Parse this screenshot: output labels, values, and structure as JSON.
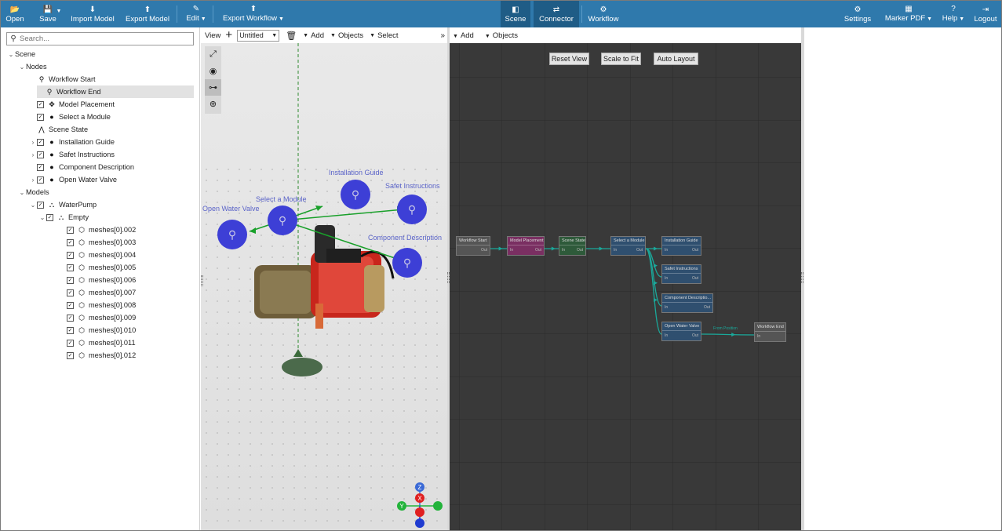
{
  "topbar": {
    "left": [
      {
        "icon": "folder-open-icon",
        "glyph": "📂",
        "label": "Open"
      },
      {
        "icon": "save-icon",
        "glyph": "💾",
        "label": "Save",
        "dropdown": true
      },
      {
        "icon": "import-model-icon",
        "glyph": "⬇",
        "label": "Import Model"
      },
      {
        "icon": "export-model-icon",
        "glyph": "⬆",
        "label": "Export Model"
      },
      {
        "icon": "edit-icon",
        "glyph": "✎",
        "label": "Edit",
        "dropdown": true
      },
      {
        "icon": "export-workflow-icon",
        "glyph": "⬆",
        "label": "Export Workflow",
        "dropdown": true
      }
    ],
    "center": [
      {
        "icon": "scene-cube-icon",
        "glyph": "◧",
        "label": "Scene"
      },
      {
        "icon": "connector-icon",
        "glyph": "⇄",
        "label": "Connector"
      },
      {
        "icon": "workflow-icon",
        "glyph": "⚙",
        "label": "Workflow"
      }
    ],
    "right": [
      {
        "icon": "settings-icon",
        "glyph": "⚙",
        "label": "Settings"
      },
      {
        "icon": "marker-pdf-icon",
        "glyph": "▦",
        "label": "Marker PDF",
        "dropdown": true
      },
      {
        "icon": "help-icon",
        "glyph": "?",
        "label": "Help",
        "dropdown": true
      },
      {
        "icon": "logout-icon",
        "glyph": "⇥",
        "label": "Logout"
      }
    ],
    "accent": "#2f79ac",
    "active_color": "#1f5c86"
  },
  "search": {
    "placeholder": "Search..."
  },
  "tree": [
    {
      "label": "Scene",
      "depth": 0,
      "twisty": "v",
      "check": false,
      "icon": ""
    },
    {
      "label": "Nodes",
      "depth": 1,
      "twisty": "v",
      "check": false,
      "icon": ""
    },
    {
      "label": "Workflow Start",
      "depth": 2,
      "twisty": "",
      "check": false,
      "icon": "pin-small-icon",
      "glyph": "⚲"
    },
    {
      "label": "Workflow End",
      "depth": 2,
      "twisty": "",
      "check": false,
      "icon": "pin-end-icon",
      "glyph": "⚲",
      "selected": true
    },
    {
      "label": "Model Placement",
      "depth": 2,
      "twisty": "",
      "check": true,
      "icon": "move-arrows-icon",
      "glyph": "✥"
    },
    {
      "label": "Select a Module",
      "depth": 2,
      "twisty": "",
      "check": true,
      "icon": "location-pin-icon",
      "glyph": "●"
    },
    {
      "label": "Scene State",
      "depth": 2,
      "twisty": "",
      "check": false,
      "icon": "state-graph-icon",
      "glyph": "⋀"
    },
    {
      "label": "Installation Guide",
      "depth": 2,
      "twisty": ">",
      "check": true,
      "icon": "location-pin-icon",
      "glyph": "●"
    },
    {
      "label": "Safet Instructions",
      "depth": 2,
      "twisty": ">",
      "check": true,
      "icon": "location-pin-icon",
      "glyph": "●"
    },
    {
      "label": "Component Description",
      "depth": 2,
      "twisty": "",
      "check": true,
      "icon": "location-pin-icon",
      "glyph": "●"
    },
    {
      "label": "Open Water Valve",
      "depth": 2,
      "twisty": ">",
      "check": true,
      "icon": "location-pin-icon",
      "glyph": "●"
    },
    {
      "label": "Models",
      "depth": 1,
      "twisty": "v",
      "check": false,
      "icon": ""
    },
    {
      "label": "WaterPump",
      "depth": 2,
      "twisty": "v",
      "check": true,
      "icon": "hierarchy-icon",
      "glyph": "⛬"
    },
    {
      "label": "Empty",
      "depth": 3,
      "twisty": "v",
      "check": true,
      "icon": "hierarchy-icon",
      "glyph": "⛬"
    },
    {
      "label": "meshes[0].002",
      "depth": 4,
      "twisty": "",
      "check": true,
      "icon": "mesh-cube-icon",
      "glyph": "⬡"
    },
    {
      "label": "meshes[0].003",
      "depth": 4,
      "twisty": "",
      "check": true,
      "icon": "mesh-cube-icon",
      "glyph": "⬡"
    },
    {
      "label": "meshes[0].004",
      "depth": 4,
      "twisty": "",
      "check": true,
      "icon": "mesh-cube-icon",
      "glyph": "⬡"
    },
    {
      "label": "meshes[0].005",
      "depth": 4,
      "twisty": "",
      "check": true,
      "icon": "mesh-cube-icon",
      "glyph": "⬡"
    },
    {
      "label": "meshes[0].006",
      "depth": 4,
      "twisty": "",
      "check": true,
      "icon": "mesh-cube-icon",
      "glyph": "⬡"
    },
    {
      "label": "meshes[0].007",
      "depth": 4,
      "twisty": "",
      "check": true,
      "icon": "mesh-cube-icon",
      "glyph": "⬡"
    },
    {
      "label": "meshes[0].008",
      "depth": 4,
      "twisty": "",
      "check": true,
      "icon": "mesh-cube-icon",
      "glyph": "⬡"
    },
    {
      "label": "meshes[0].009",
      "depth": 4,
      "twisty": "",
      "check": true,
      "icon": "mesh-cube-icon",
      "glyph": "⬡"
    },
    {
      "label": "meshes[0].010",
      "depth": 4,
      "twisty": "",
      "check": true,
      "icon": "mesh-cube-icon",
      "glyph": "⬡"
    },
    {
      "label": "meshes[0].011",
      "depth": 4,
      "twisty": "",
      "check": true,
      "icon": "mesh-cube-icon",
      "glyph": "⬡"
    },
    {
      "label": "meshes[0].012",
      "depth": 4,
      "twisty": "",
      "check": true,
      "icon": "mesh-cube-icon",
      "glyph": "⬡"
    }
  ],
  "scene_toolbar": {
    "view_label": "View",
    "add_icon": "plus-icon",
    "document_name": "Untitled",
    "delete_icon": "trash-icon",
    "add_label": "Add",
    "objects_label": "Objects",
    "select_label": "Select",
    "overflow": "»"
  },
  "viewport": {
    "tools": [
      {
        "icon": "expand-icon",
        "glyph": "⤢"
      },
      {
        "icon": "eye-icon",
        "glyph": "◉"
      },
      {
        "icon": "connector-link-icon",
        "glyph": "⊶",
        "active": true
      },
      {
        "icon": "move-gizmo-icon",
        "glyph": "⊕"
      }
    ],
    "markers": [
      {
        "label": "Installation Guide"
      },
      {
        "label": "Select a Module"
      },
      {
        "label": "Safet Instructions"
      },
      {
        "label": "Open Water Valve"
      },
      {
        "label": "Component Description"
      }
    ],
    "gizmo": {
      "z": "Z",
      "y": "Y",
      "x": "X"
    },
    "marker_color": "#3d3fd6",
    "arrow_color": "#19a02a"
  },
  "connector_toolbar": {
    "add_label": "Add",
    "objects_label": "Objects"
  },
  "connector": {
    "buttons": {
      "reset": "Reset View",
      "scale": "Scale to Fit",
      "auto": "Auto Layout"
    },
    "nodes": [
      {
        "id": "ws",
        "title": "Workflow Start",
        "in": "",
        "out": "Out",
        "color": "#555555"
      },
      {
        "id": "mp",
        "title": "Model Placement",
        "in": "In",
        "out": "Out",
        "color": "#7a2f62"
      },
      {
        "id": "ss",
        "title": "Scene State",
        "in": "In",
        "out": "Out",
        "color": "#2e5a3a"
      },
      {
        "id": "sm",
        "title": "Select a Module",
        "in": "In",
        "out": "Out",
        "color": "#2f4f6f"
      },
      {
        "id": "ig",
        "title": "Installation Guide",
        "in": "In",
        "out": "Out",
        "color": "#2f4f6f"
      },
      {
        "id": "si",
        "title": "Safet Instructions",
        "in": "In",
        "out": "Out",
        "color": "#2f4f6f"
      },
      {
        "id": "cd",
        "title": "Component Descriptio...",
        "in": "In",
        "out": "Out",
        "color": "#2f4f6f"
      },
      {
        "id": "ow",
        "title": "Open Water Valve",
        "in": "In",
        "out": "Out",
        "color": "#2f4f6f"
      },
      {
        "id": "we",
        "title": "Workflow End",
        "in": "In",
        "out": "",
        "color": "#555555"
      }
    ],
    "edge_label": "From Position",
    "edge_color": "#1aa89a"
  }
}
